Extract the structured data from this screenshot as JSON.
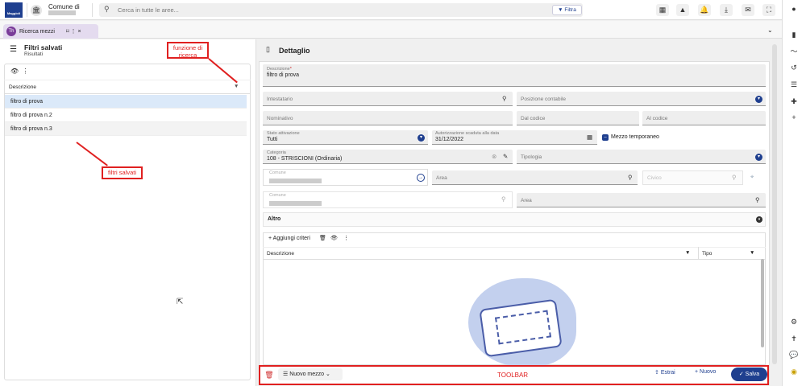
{
  "topbar": {
    "logo_text": "Maggioli",
    "comune_label": "Comune di",
    "search_placeholder": "Cerca in tutte le aree...",
    "filter_label": "▼ Filtra",
    "icons": [
      "grid-icon",
      "warning-icon",
      "bell-icon",
      "download-icon",
      "mail-icon",
      "fullscreen-icon"
    ]
  },
  "rail": {
    "icons": [
      "account-icon",
      "book-icon",
      "trend-icon",
      "history-icon",
      "list-icon",
      "puzzle-icon",
      "plus-icon",
      "settings-icon",
      "accessibility-icon",
      "chat-icon",
      "support-icon"
    ]
  },
  "tab": {
    "badge": "Th",
    "label": "Ricerca mezzi",
    "actions": "⌑  ⋮  ×"
  },
  "left": {
    "title": "Filtri salvati",
    "subtitle": "Risultati",
    "column_header": "Descrizione",
    "rows": [
      "filtro di prova",
      "filtro di prova n.2",
      "filtro di prova n.3"
    ]
  },
  "annotations": {
    "search_func": "funzione di ricerca",
    "saved_filters": "filtri salvati",
    "toolbar": "TOOLBAR"
  },
  "detail": {
    "title": "Dettaglio",
    "descrizione_label": "Descrizione",
    "descrizione_value": "filtro di prova",
    "intestatario": "Intestatario",
    "posizione_contabile": "Posizione contabile",
    "nominativo": "Nominativo",
    "dal_codice": "Dal codice",
    "al_codice": "Al codice",
    "stato_label": "Stato attivazione",
    "stato_value": "Tutti",
    "autorizzazione_label": "Autorizzazione scaduta alla data",
    "autorizzazione_value": "31/12/2022",
    "mezzo_temporaneo": "Mezzo temporaneo",
    "categoria_label": "Categoria",
    "categoria_value": "108 - STRISCIONI (Ordinaria)",
    "tipologia": "Tipologia",
    "comune": "Comune",
    "area": "Area",
    "civico": "Civico",
    "altro": "Altro",
    "aggiungi_criteri": "+ Aggiungi criteri",
    "col_descrizione": "Descrizione",
    "col_tipo": "Tipo"
  },
  "toolbar": {
    "nuovo_mezzo": "Nuovo mezzo",
    "estrai": "Estrai",
    "nuovo": "Nuovo",
    "salva": "Salva"
  },
  "colors": {
    "primary": "#1f3f8f",
    "annotation": "#e02020",
    "tab_accent": "#7a3c99"
  }
}
